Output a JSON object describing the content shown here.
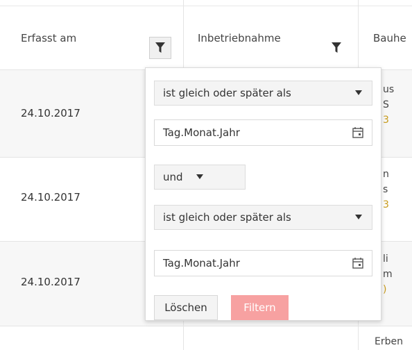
{
  "columns": [
    {
      "label": "Erfasst am",
      "filter_icon": "funnel-icon",
      "filter_active": true
    },
    {
      "label": "Inbetriebnahme",
      "filter_icon": "funnel-icon",
      "filter_active": false
    },
    {
      "label": "Bauhe"
    }
  ],
  "rows": [
    {
      "date": "24.10.2017",
      "peek": [
        "us",
        "S",
        "3"
      ]
    },
    {
      "date": "24.10.2017",
      "peek": [
        "n",
        "s",
        "3"
      ]
    },
    {
      "date": "24.10.2017",
      "peek": [
        "li",
        "m",
        ")"
      ]
    },
    {
      "date": "",
      "peek": [
        "Erben"
      ]
    }
  ],
  "filter_popup": {
    "operator1": "ist gleich oder später als",
    "date1_placeholder": "Tag.Monat.Jahr",
    "logic": "und",
    "operator2": "ist gleich oder später als",
    "date2_placeholder": "Tag.Monat.Jahr",
    "clear_label": "Löschen",
    "filter_label": "Filtern",
    "accent_color": "#f7a1a1"
  },
  "icons": {
    "filter": "funnel-icon",
    "calendar": "calendar-icon",
    "dropdown": "caret-down-icon"
  }
}
